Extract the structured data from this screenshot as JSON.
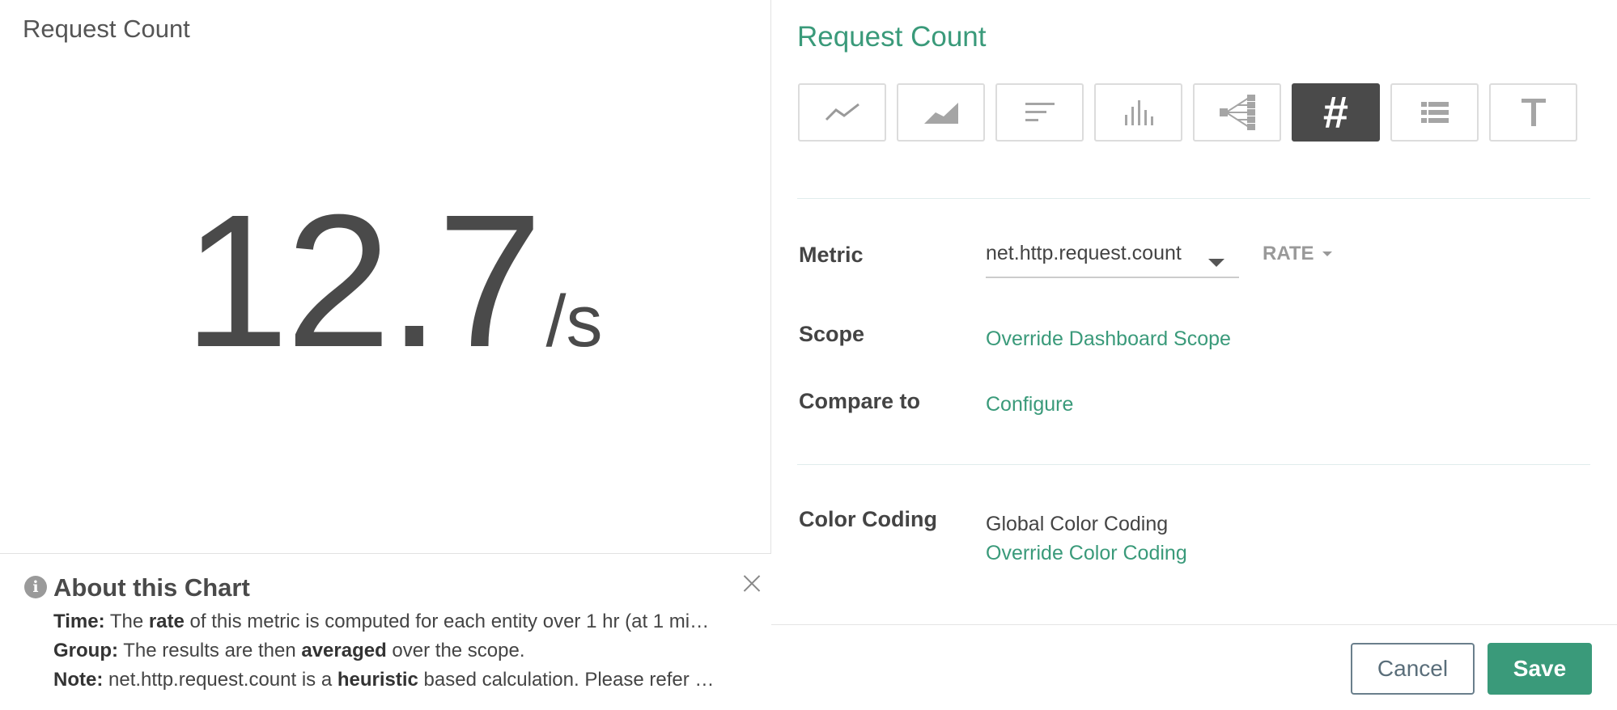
{
  "left": {
    "chart_title": "Request Count",
    "value": "12.7",
    "unit": "/s"
  },
  "about": {
    "title": "About this Chart",
    "lines": [
      {
        "k1": "Time:",
        "t1": " The ",
        "b1": "rate",
        "t2": " of this metric is computed for each entity over 1 hr (at 1 mi…"
      },
      {
        "k1": "Group:",
        "t1": " The results are then ",
        "b1": "averaged",
        "t2": " over the scope."
      },
      {
        "k1": "Note:",
        "t1": " net.http.request.count is a ",
        "b1": "heuristic",
        "t2": " based calculation. Please refer …"
      }
    ]
  },
  "editor": {
    "title": "Request Count",
    "chart_types": [
      {
        "name": "line-chart-icon",
        "active": false
      },
      {
        "name": "area-chart-icon",
        "active": false
      },
      {
        "name": "top-list-icon",
        "active": false
      },
      {
        "name": "histogram-icon",
        "active": false
      },
      {
        "name": "topology-icon",
        "active": false
      },
      {
        "name": "number-icon",
        "active": true
      },
      {
        "name": "table-icon",
        "active": false
      },
      {
        "name": "text-icon",
        "active": false
      }
    ],
    "metric_label": "Metric",
    "metric_value": "net.http.request.count",
    "aggregation": "RATE",
    "scope_label": "Scope",
    "scope_link": "Override Dashboard Scope",
    "compare_label": "Compare to",
    "compare_link": "Configure",
    "color_label": "Color Coding",
    "color_static": "Global Color Coding",
    "color_link": "Override Color Coding",
    "cancel": "Cancel",
    "save": "Save"
  },
  "colors": {
    "accent": "#3a9a7a",
    "active_tile": "#4a4a4a"
  }
}
